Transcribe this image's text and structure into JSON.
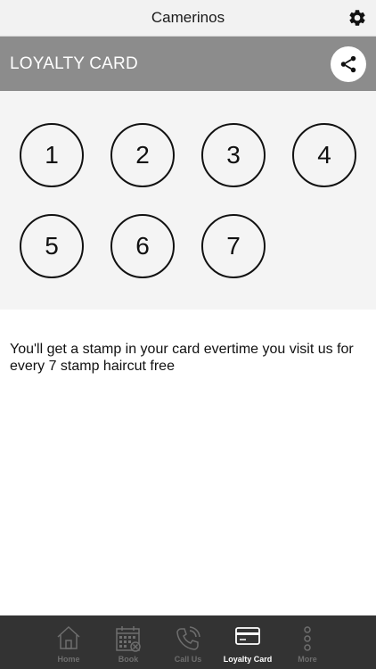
{
  "navbar": {
    "title": "Camerinos",
    "settings_icon": "gear-icon"
  },
  "header": {
    "title": "LOYALTY CARD",
    "share_icon": "share-icon"
  },
  "stamps": [
    "1",
    "2",
    "3",
    "4",
    "5",
    "6",
    "7"
  ],
  "description": "You'll get a stamp in your card evertime you visit us for every 7 stamp haircut free",
  "tabs": [
    {
      "label": "Home",
      "icon": "home-icon",
      "active": false
    },
    {
      "label": "Book",
      "icon": "calendar-icon",
      "active": false
    },
    {
      "label": "Call Us",
      "icon": "phone-icon",
      "active": false
    },
    {
      "label": "Loyalty Card",
      "icon": "card-icon",
      "active": true
    },
    {
      "label": "More",
      "icon": "more-icon",
      "active": false
    }
  ],
  "colors": {
    "header_bg": "#8c8c8c",
    "tabbar_bg": "#333333",
    "active_tab": "#ffffff",
    "inactive_tab": "#6e6e6e"
  }
}
